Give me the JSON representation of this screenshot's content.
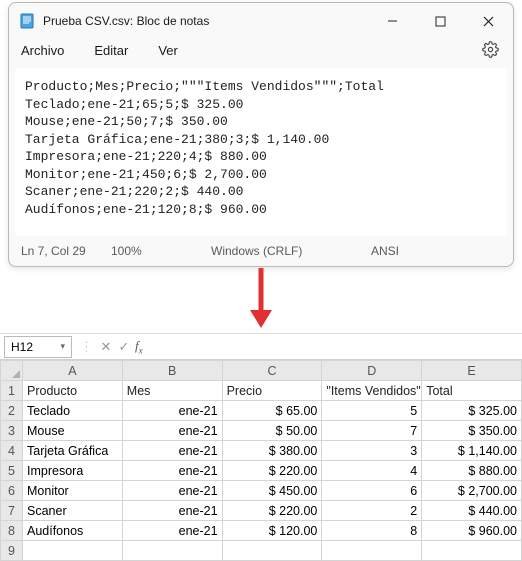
{
  "notepad": {
    "title": "Prueba CSV.csv: Bloc de notas",
    "menu": {
      "file": "Archivo",
      "edit": "Editar",
      "view": "Ver"
    },
    "lines": [
      "Producto;Mes;Precio;\"\"\"Items Vendidos\"\"\";Total",
      "Teclado;ene-21;65;5;$ 325.00",
      "Mouse;ene-21;50;7;$ 350.00",
      "Tarjeta Gráfica;ene-21;380;3;$ 1,140.00",
      "Impresora;ene-21;220;4;$ 880.00",
      "Monitor;ene-21;450;6;$ 2,700.00",
      "Scaner;ene-21;220;2;$ 440.00",
      "Audífonos;ene-21;120;8;$ 960.00"
    ],
    "status": {
      "pos": "Ln 7, Col 29",
      "zoom": "100%",
      "eol": "Windows (CRLF)",
      "enc": "ANSI"
    }
  },
  "excel": {
    "namebox": "H12",
    "col_labels": [
      "A",
      "B",
      "C",
      "D",
      "E"
    ],
    "headers": [
      "Producto",
      "Mes",
      "Precio",
      "\"Items Vendidos\"",
      "Total"
    ],
    "rows": [
      {
        "n": "2",
        "A": "Teclado",
        "B": "ene-21",
        "C": "$ 65.00",
        "D": "5",
        "E": "$ 325.00"
      },
      {
        "n": "3",
        "A": "Mouse",
        "B": "ene-21",
        "C": "$ 50.00",
        "D": "7",
        "E": "$ 350.00"
      },
      {
        "n": "4",
        "A": "Tarjeta Gráfica",
        "B": "ene-21",
        "C": "$ 380.00",
        "D": "3",
        "E": "$ 1,140.00"
      },
      {
        "n": "5",
        "A": "Impresora",
        "B": "ene-21",
        "C": "$ 220.00",
        "D": "4",
        "E": "$ 880.00"
      },
      {
        "n": "6",
        "A": "Monitor",
        "B": "ene-21",
        "C": "$ 450.00",
        "D": "6",
        "E": "$ 2,700.00"
      },
      {
        "n": "7",
        "A": "Scaner",
        "B": "ene-21",
        "C": "$ 220.00",
        "D": "2",
        "E": "$ 440.00"
      },
      {
        "n": "8",
        "A": "Audífonos",
        "B": "ene-21",
        "C": "$ 120.00",
        "D": "8",
        "E": "$ 960.00"
      }
    ],
    "last_row": "9"
  }
}
